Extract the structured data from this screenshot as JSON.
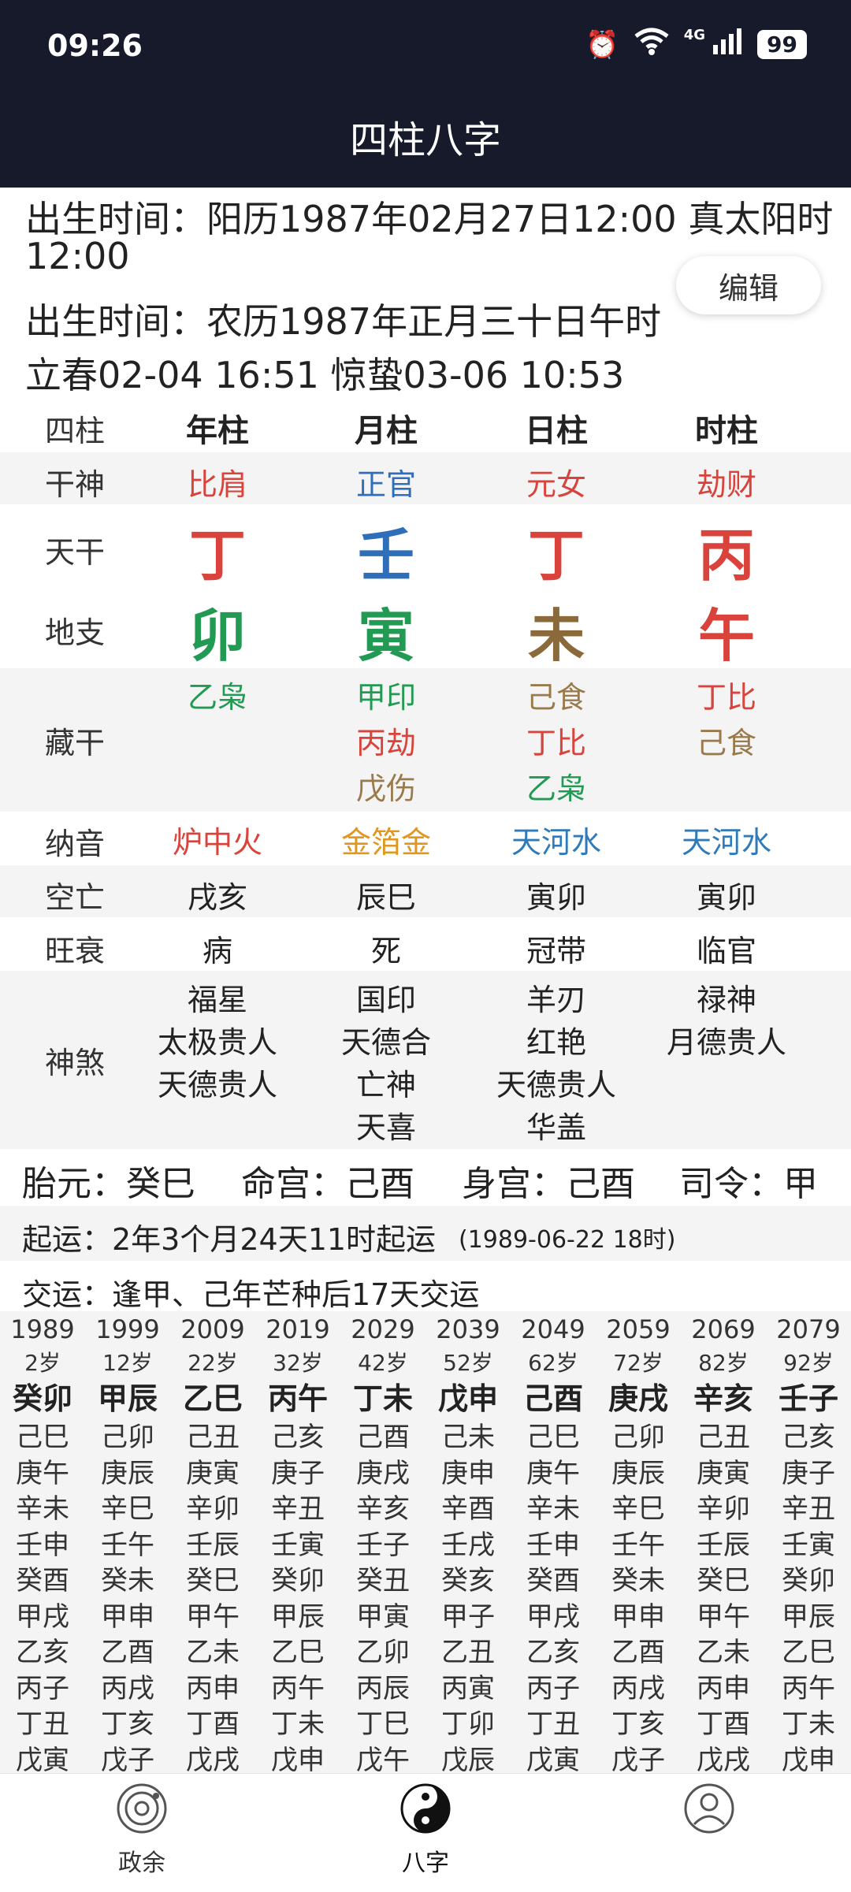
{
  "status": {
    "time": "09:26",
    "network": "4G",
    "battery": "99"
  },
  "header": {
    "title": "四柱八字"
  },
  "info": {
    "birth_solar": "出生时间：阳历1987年02月27日12:00 真太阳时",
    "birth_solar_time": "12:00",
    "birth_lunar": "出生时间：农历1987年正月三十日午时",
    "solar_terms": "立春02-04 16:51 惊蛰03-06 10:53",
    "edit_label": "编辑"
  },
  "pillars": {
    "row_label": "四柱",
    "headers": [
      "年柱",
      "月柱",
      "日柱",
      "时柱"
    ],
    "gan_shen_label": "干神",
    "gan_shen": [
      "比肩",
      "正官",
      "元女",
      "劫财"
    ],
    "tian_gan_label": "天干",
    "tian_gan": [
      "丁",
      "壬",
      "丁",
      "丙"
    ],
    "di_zhi_label": "地支",
    "di_zhi": [
      "卯",
      "寅",
      "未",
      "午"
    ],
    "cang_gan_label": "藏干",
    "cang_gan": [
      [
        "乙枭"
      ],
      [
        "甲印",
        "丙劫",
        "戊伤"
      ],
      [
        "己食",
        "丁比",
        "乙枭"
      ],
      [
        "丁比",
        "己食"
      ]
    ],
    "na_yin_label": "纳音",
    "na_yin": [
      "炉中火",
      "金箔金",
      "天河水",
      "天河水"
    ],
    "kong_wang_label": "空亡",
    "kong_wang": [
      "戌亥",
      "辰巳",
      "寅卯",
      "寅卯"
    ],
    "wang_shuai_label": "旺衰",
    "wang_shuai": [
      "病",
      "死",
      "冠带",
      "临官"
    ],
    "shen_sha_label": "神煞",
    "shen_sha": [
      [
        "福星",
        "太极贵人",
        "天德贵人"
      ],
      [
        "国印",
        "天德合",
        "亡神",
        "天喜"
      ],
      [
        "羊刃",
        "红艳",
        "天德贵人",
        "华盖"
      ],
      [
        "禄神",
        "月德贵人"
      ]
    ]
  },
  "extra": {
    "tai_yuan": "胎元：癸巳",
    "ming_gong": "命宫：己酉",
    "shen_gong": "身宫：己酉",
    "si_ling": "司令：甲",
    "qi_yun": "起运：2年3个月24天11时起运",
    "qi_yun_date": "(1989-06-22 18时)",
    "jiao_yun": "交运：逢甲、己年芒种后17天交运"
  },
  "dayun": [
    {
      "year": "1989",
      "age": "2岁",
      "gz": "癸卯",
      "years": [
        "己巳",
        "庚午",
        "辛未",
        "壬申",
        "癸酉",
        "甲戌",
        "乙亥",
        "丙子",
        "丁丑",
        "戊寅"
      ]
    },
    {
      "year": "1999",
      "age": "12岁",
      "gz": "甲辰",
      "years": [
        "己卯",
        "庚辰",
        "辛巳",
        "壬午",
        "癸未",
        "甲申",
        "乙酉",
        "丙戌",
        "丁亥",
        "戊子"
      ]
    },
    {
      "year": "2009",
      "age": "22岁",
      "gz": "乙巳",
      "years": [
        "己丑",
        "庚寅",
        "辛卯",
        "壬辰",
        "癸巳",
        "甲午",
        "乙未",
        "丙申",
        "丁酉",
        "戊戌"
      ]
    },
    {
      "year": "2019",
      "age": "32岁",
      "gz": "丙午",
      "years": [
        "己亥",
        "庚子",
        "辛丑",
        "壬寅",
        "癸卯",
        "甲辰",
        "乙巳",
        "丙午",
        "丁未",
        "戊申"
      ]
    },
    {
      "year": "2029",
      "age": "42岁",
      "gz": "丁未",
      "years": [
        "己酉",
        "庚戌",
        "辛亥",
        "壬子",
        "癸丑",
        "甲寅",
        "乙卯",
        "丙辰",
        "丁巳",
        "戊午"
      ]
    },
    {
      "year": "2039",
      "age": "52岁",
      "gz": "戊申",
      "years": [
        "己未",
        "庚申",
        "辛酉",
        "壬戌",
        "癸亥",
        "甲子",
        "乙丑",
        "丙寅",
        "丁卯",
        "戊辰"
      ]
    },
    {
      "year": "2049",
      "age": "62岁",
      "gz": "己酉",
      "years": [
        "己巳",
        "庚午",
        "辛未",
        "壬申",
        "癸酉",
        "甲戌",
        "乙亥",
        "丙子",
        "丁丑",
        "戊寅"
      ]
    },
    {
      "year": "2059",
      "age": "72岁",
      "gz": "庚戌",
      "years": [
        "己卯",
        "庚辰",
        "辛巳",
        "壬午",
        "癸未",
        "甲申",
        "乙酉",
        "丙戌",
        "丁亥",
        "戊子"
      ]
    },
    {
      "year": "2069",
      "age": "82岁",
      "gz": "辛亥",
      "years": [
        "己丑",
        "庚寅",
        "辛卯",
        "壬辰",
        "癸巳",
        "甲午",
        "乙未",
        "丙申",
        "丁酉",
        "戊戌"
      ]
    },
    {
      "year": "2079",
      "age": "92岁",
      "gz": "壬子",
      "years": [
        "己亥",
        "庚子",
        "辛丑",
        "壬寅",
        "癸卯",
        "甲辰",
        "乙巳",
        "丙午",
        "丁未",
        "戊申"
      ]
    }
  ],
  "nav": {
    "items": [
      {
        "label": "政余",
        "icon": "orbit-icon"
      },
      {
        "label": "八字",
        "icon": "yin-yang-icon"
      },
      {
        "label": "",
        "icon": "profile-icon"
      }
    ]
  }
}
